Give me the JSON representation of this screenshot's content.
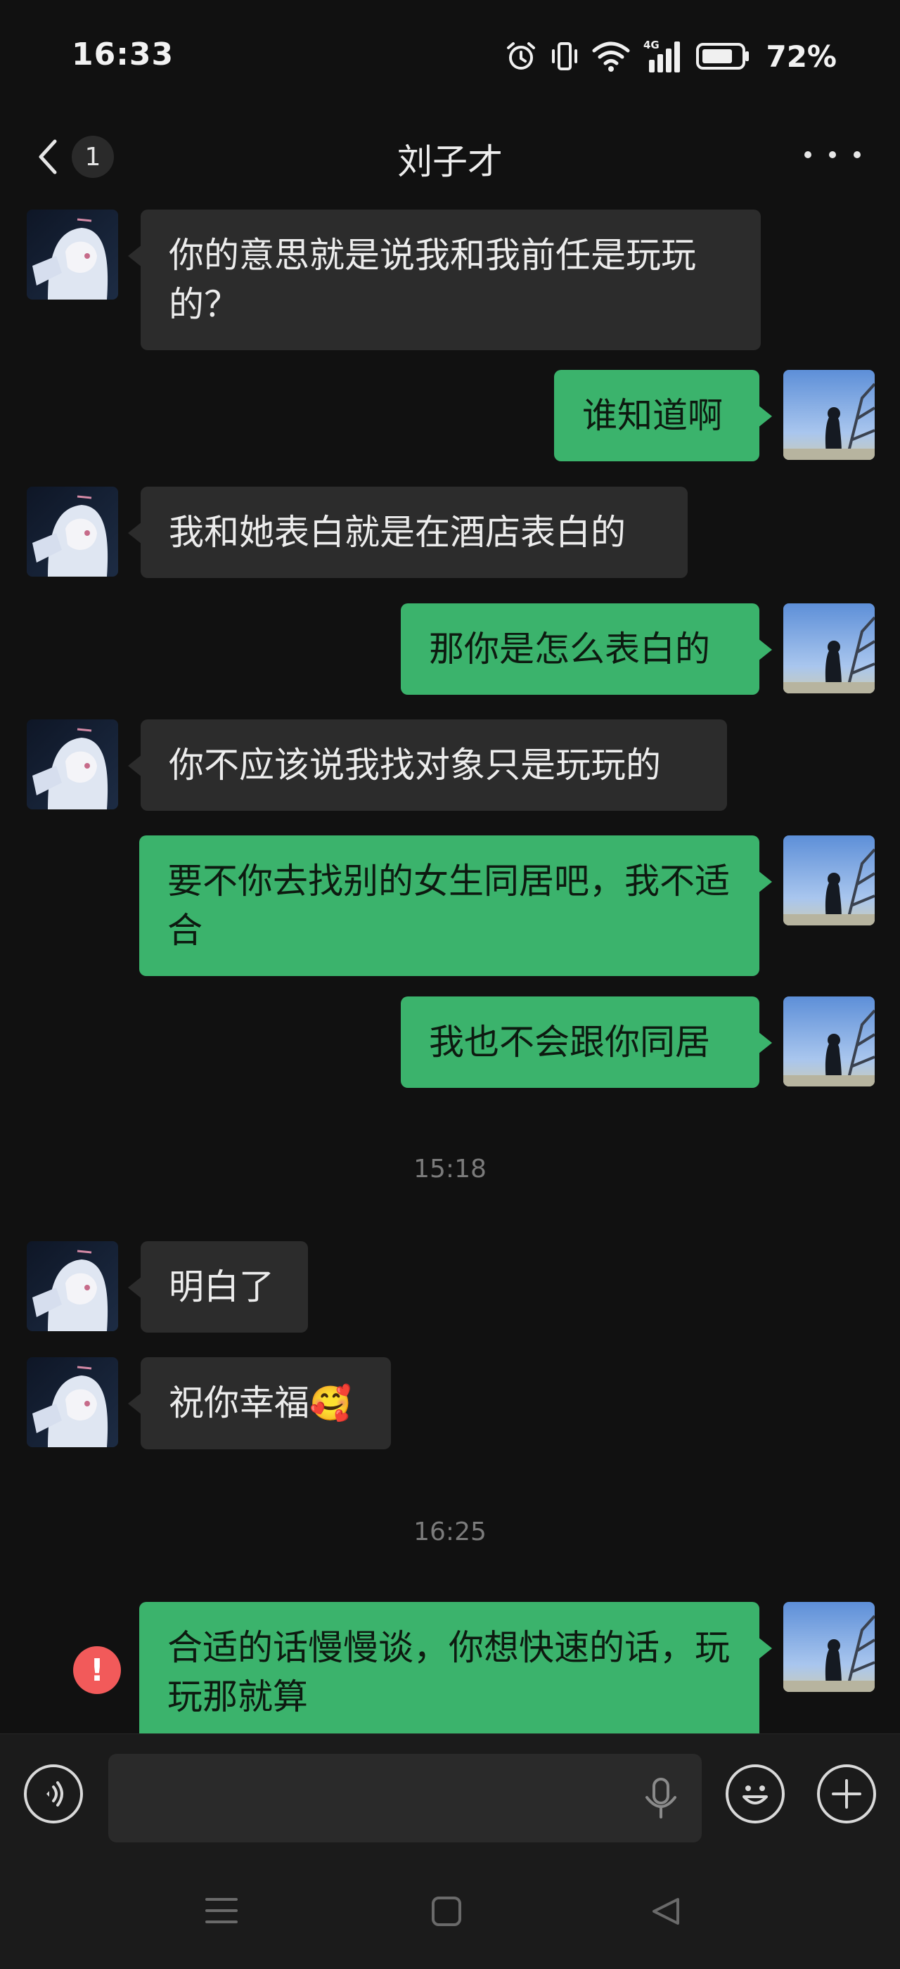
{
  "status_bar": {
    "time": "16:33",
    "network": "4G",
    "battery": "72%",
    "icons": [
      "alarm-icon",
      "vibrate-icon",
      "wifi-icon",
      "cell-signal-icon",
      "battery-icon"
    ]
  },
  "header": {
    "unread_count": "1",
    "title": "刘子才",
    "back_icon": "chevron-left-icon",
    "more_icon": "more-dots-icon"
  },
  "messages": [
    {
      "side": "in",
      "text": "你的意思就是说我和我前任是玩玩的？"
    },
    {
      "side": "out",
      "text": "谁知道啊"
    },
    {
      "side": "in",
      "text": "我和她表白就是在酒店表白的"
    },
    {
      "side": "out",
      "text": "那你是怎么表白的"
    },
    {
      "side": "in",
      "text": "你不应该说我找对象只是玩玩的"
    },
    {
      "side": "out",
      "text": " 要不你去找别的女生同居吧，我不适合"
    },
    {
      "side": "out",
      "text": "我也不会跟你同居"
    },
    {
      "type": "time",
      "text": "15:18"
    },
    {
      "side": "in",
      "text": "明白了"
    },
    {
      "side": "in",
      "text": "祝你幸福",
      "emoji": "🥰"
    },
    {
      "type": "time",
      "text": "16:25"
    },
    {
      "side": "out",
      "text": "合适的话慢慢谈，你想快速的话，玩玩那就算",
      "status": "failed",
      "status_text": "!"
    }
  ],
  "input_bar": {
    "voice_icon": "voice-mode-icon",
    "mic_icon": "microphone-icon",
    "emoji_icon": "emoji-icon",
    "plus_icon": "plus-icon",
    "value": ""
  },
  "nav_bar": {
    "icons": [
      "menu-icon",
      "home-icon",
      "back-icon"
    ]
  },
  "colors": {
    "background": "#111111",
    "incoming_bubble": "#2c2c2c",
    "outgoing_bubble": "#3bb36c",
    "error": "#f25a5a"
  }
}
